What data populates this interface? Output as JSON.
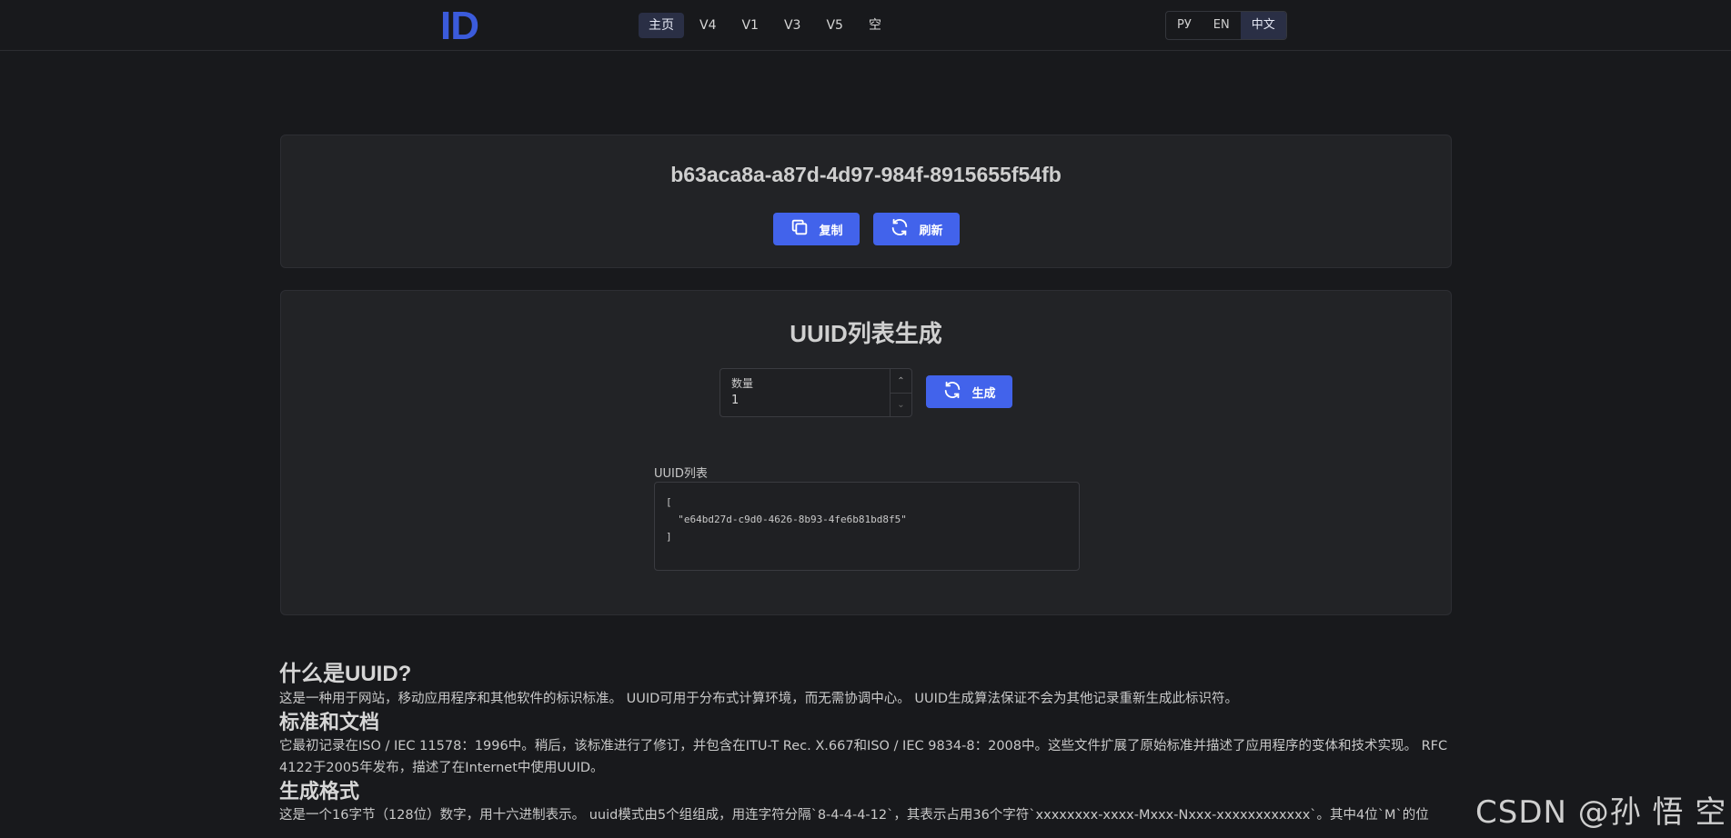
{
  "header": {
    "logo": "ID",
    "nav": [
      "主页",
      "V4",
      "V1",
      "V3",
      "V5",
      "空"
    ],
    "active_nav": 0,
    "langs": [
      "РУ",
      "EN",
      "中文"
    ],
    "active_lang": 2
  },
  "generator": {
    "uuid": "b63aca8a-a87d-4d97-984f-8915655f54fb",
    "copy_label": "复制",
    "refresh_label": "刷新"
  },
  "list_section": {
    "title": "UUID列表生成",
    "quantity_label": "数量",
    "quantity_value": "1",
    "generate_label": "生成",
    "list_label": "UUID列表",
    "list_content": "[\n  \"e64bd27d-c9d0-4626-8b93-4fe6b81bd8f5\"\n]"
  },
  "article": {
    "h_what": "什么是UUID?",
    "p_what": "这是一种用于网站，移动应用程序和其他软件的标识标准。 UUID可用于分布式计算环境，而无需协调中心。 UUID生成算法保证不会为其他记录重新生成此标识符。",
    "h_standard": "标准和文档",
    "p_standard": "它最初记录在ISO / IEC 11578：1996中。稍后，该标准进行了修订，并包含在ITU-T Rec. X.667和ISO / IEC 9834-8：2008中。这些文件扩展了原始标准并描述了应用程序的变体和技术实现。 RFC 4122于2005年发布，描述了在Internet中使用UUID。",
    "h_format": "生成格式",
    "p_format": "这是一个16字节（128位）数字，用十六进制表示。 uuid模式由5个组组成，用连字符分隔`8-4-4-4-12`，其表示占用36个字符`xxxxxxxx-xxxx-Mxxx-Nxxx-xxxxxxxxxxxx`。其中4位`M`的位"
  },
  "watermark": "CSDN @孙 悟 空"
}
